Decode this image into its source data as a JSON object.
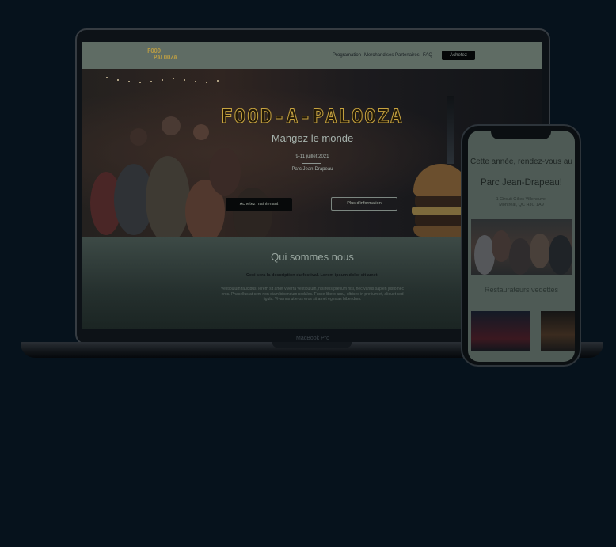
{
  "laptop": {
    "model_label": "MacBook Pro",
    "site": {
      "logo_line1": "FOOD",
      "logo_line2": "PALOOZA",
      "nav": [
        "Programation",
        "Merchandises",
        "Partenaires",
        "FAQ"
      ],
      "nav_button": "Achetez",
      "hero": {
        "title": "FOOD-A-PALOOZA",
        "subtitle": "Mangez le monde",
        "date": "9-11 juillet 2021",
        "place": "Parc Jean-Drapeau",
        "button_buy": "Achetez maintenant",
        "button_info": "Plus d'information"
      },
      "about": {
        "title": "Qui sommes nous",
        "lead": "Ceci sera la description du festival. Lorem ipsum dolor sit amet.",
        "body": "Vestibulum faucibus, lorem sit amet viverra vestibulum, nisl felis pretium nisi, nec varius sapien justo nec eros. Phasellus at sem non diam bibendum sodales. Fusce libero arcu, ultrices in pretium et, aliquet sed ligula. Vivamus ut eros eros sit amet egestas bibendum."
      }
    }
  },
  "phone": {
    "title": "Cette année, rendez-vous au",
    "venue": "Parc Jean-Drapeau!",
    "address_line1": "1 Circuit Gilles Villeneuve,",
    "address_line2": "Montréal, QC H3C 1A9",
    "section_title": "Restaurateurs vedettes"
  },
  "colors": {
    "background": "#06121c",
    "header": "#5f6c64",
    "accent_gold": "#c7a340"
  }
}
